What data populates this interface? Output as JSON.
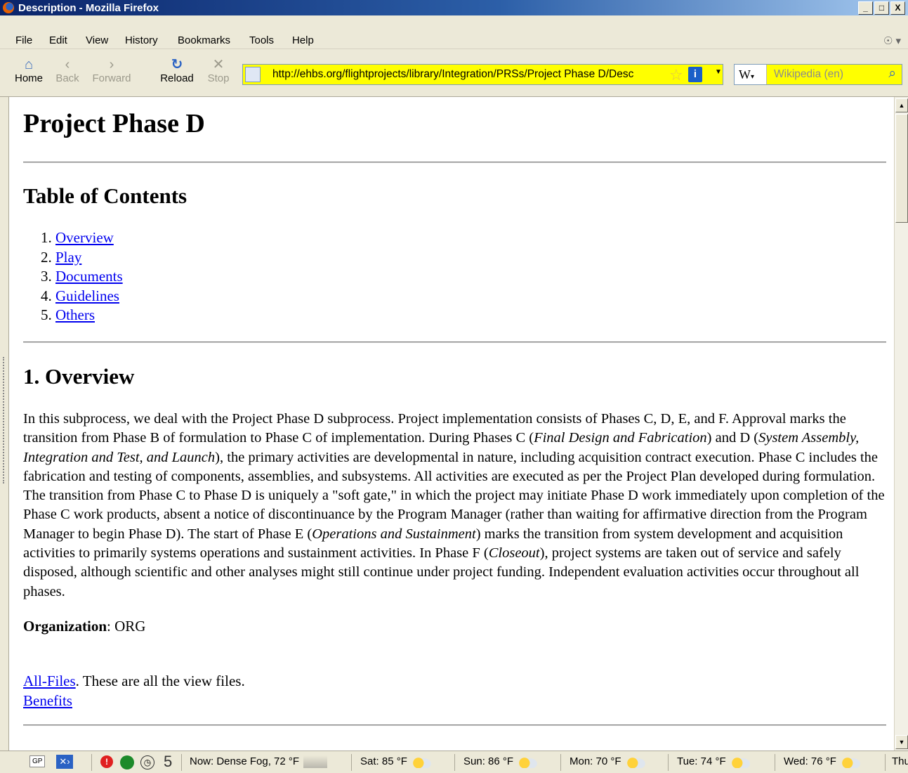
{
  "window": {
    "title": "Description - Mozilla Firefox",
    "buttons": [
      "_",
      "□",
      "X"
    ]
  },
  "menu": [
    "File",
    "Edit",
    "View",
    "History",
    "Bookmarks",
    "Tools",
    "Help"
  ],
  "toolbar": {
    "home": "Home",
    "back": "Back",
    "forward": "Forward",
    "reload": "Reload",
    "stop": "Stop"
  },
  "address": {
    "url": "http://ehbs.org/flightprojects/library/Integration/PRSs/Project Phase D/Desc"
  },
  "search": {
    "engine": "W",
    "placeholder": "Wikipedia (en)"
  },
  "page": {
    "title": "Project Phase D",
    "toc_heading": "Table of Contents",
    "toc": [
      {
        "num": "1.",
        "label": "Overview"
      },
      {
        "num": "2.",
        "label": "Play"
      },
      {
        "num": "3.",
        "label": "Documents"
      },
      {
        "num": "4.",
        "label": "Guidelines"
      },
      {
        "num": "5.",
        "label": "Others"
      }
    ],
    "overview_heading": "1. Overview",
    "para": {
      "p1": "In this subprocess, we deal with the Project Phase D subprocess. Project implementation consists of Phases C, D, E, and F. Approval marks the transition from Phase B of formulation to Phase C of implementation. During Phases C (",
      "i1": "Final Design and Fabrication",
      "p2": ") and D (",
      "i2": "System Assembly, Integration and Test, and Launch",
      "p3": "), the primary activities are developmental in nature, including acquisition contract execution. Phase C includes the fabrication and testing of components, assemblies, and subsystems. All activities are executed as per the Project Plan developed during formulation. The transition from Phase C to Phase D is uniquely a \"soft gate,\" in which the project may initiate Phase D work immediately upon completion of the Phase C work products, absent a notice of discontinuance by the Program Manager (rather than waiting for affirmative direction from the Program Manager to begin Phase D). The start of Phase E (",
      "i3": "Operations and Sustainment",
      "p4": ") marks the transition from system development and acquisition activities to primarily systems operations and sustainment activities. In Phase F (",
      "i4": "Closeout",
      "p5": "), project systems are taken out of service and safely disposed, although scientific and other analyses might still continue under project funding. Independent evaluation activities occur throughout all phases."
    },
    "organization_label": "Organization",
    "organization_value": ": ORG",
    "allfiles_link": "All-Files",
    "allfiles_text": ". These are all the view files.",
    "benefits_link": "Benefits"
  },
  "status": {
    "gp": "GP",
    "count": "5",
    "now": "Now: Dense Fog, 72 °F",
    "sat": "Sat: 85 °F",
    "sun": "Sun: 86 °F",
    "mon": "Mon: 70 °F",
    "tue": "Tue: 74 °F",
    "wed": "Wed: 76 °F",
    "thu": "Thu"
  }
}
